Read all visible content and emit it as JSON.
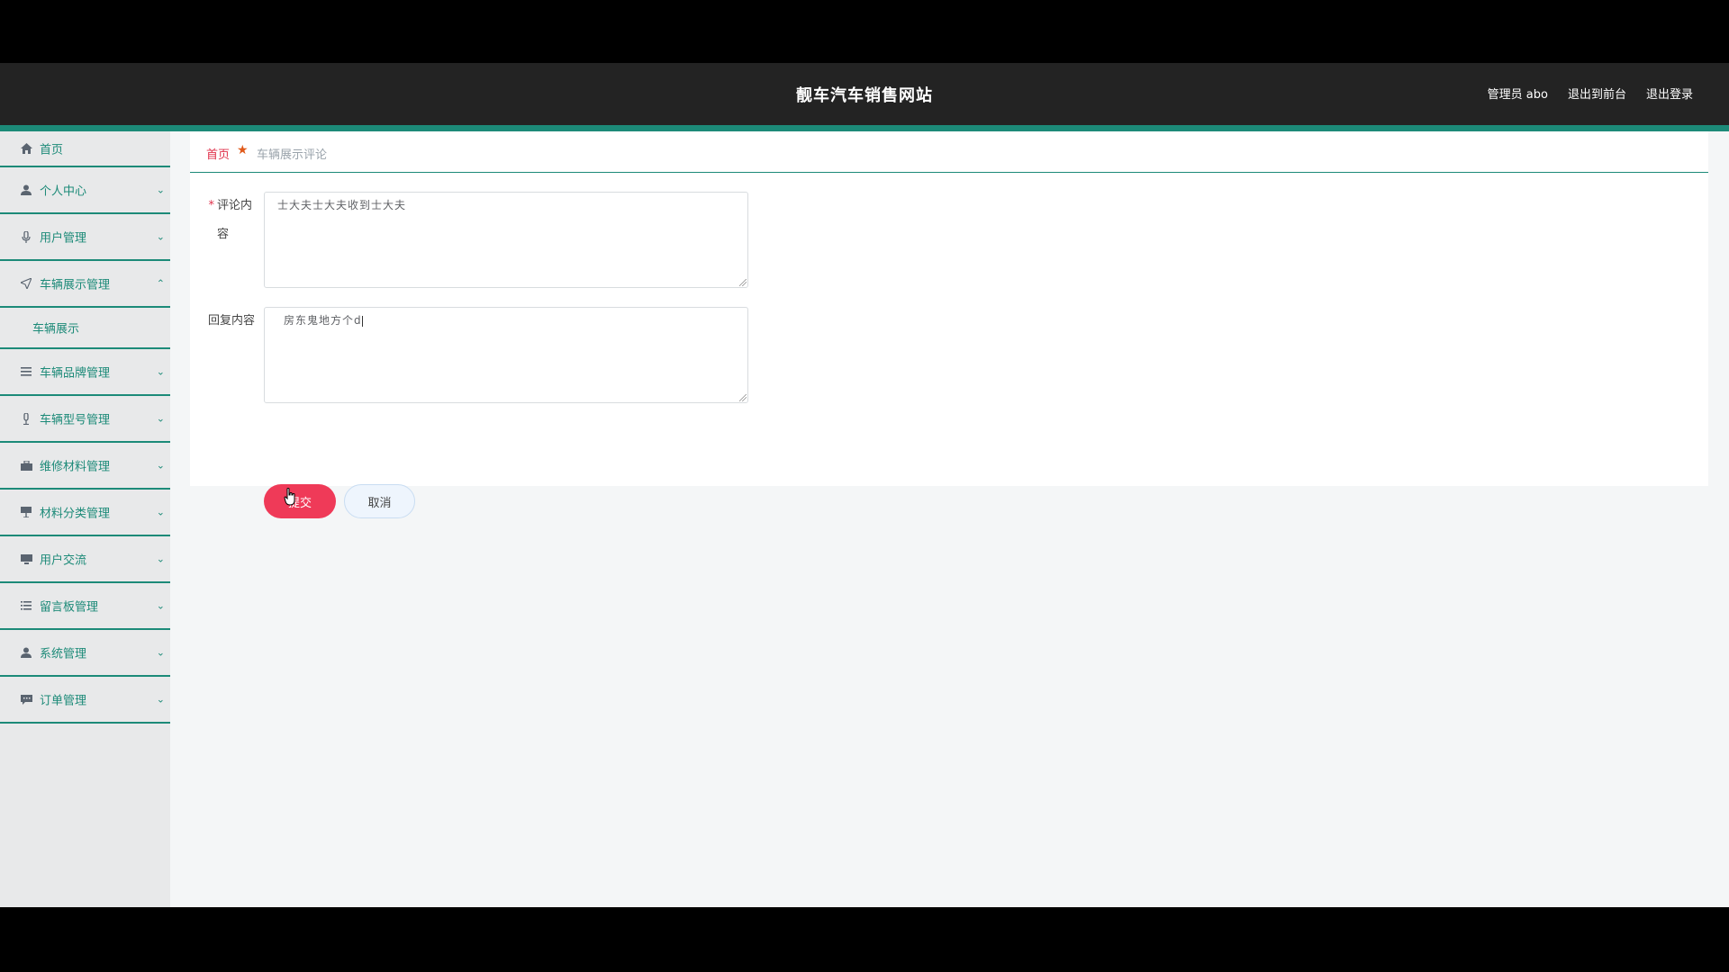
{
  "header": {
    "site_title": "靓车汽车销售网站",
    "admin_label": "管理员 abo",
    "exit_front": "退出到前台",
    "logout": "退出登录"
  },
  "sidebar": {
    "items": [
      {
        "label": "首页",
        "icon": "home-icon"
      },
      {
        "label": "个人中心",
        "icon": "user-icon"
      },
      {
        "label": "用户管理",
        "icon": "microphone-icon"
      },
      {
        "label": "车辆展示管理",
        "icon": "send-icon",
        "expanded": true
      },
      {
        "label": "车辆展示",
        "icon": ""
      },
      {
        "label": "车辆品牌管理",
        "icon": "list-icon"
      },
      {
        "label": "车辆型号管理",
        "icon": "microphone-icon"
      },
      {
        "label": "维修材料管理",
        "icon": "briefcase-icon"
      },
      {
        "label": "材料分类管理",
        "icon": "presentation-icon"
      },
      {
        "label": "用户交流",
        "icon": "monitor-icon"
      },
      {
        "label": "留言板管理",
        "icon": "list-icon"
      },
      {
        "label": "系统管理",
        "icon": "user-icon"
      },
      {
        "label": "订单管理",
        "icon": "chat-icon"
      }
    ]
  },
  "breadcrumb": {
    "home": "首页",
    "separator_icon": "star-icon",
    "current": "车辆展示评论"
  },
  "form": {
    "comment_label": "评论内容",
    "comment_value": "士大夫士大夫收到士大夫",
    "reply_label": "回复内容",
    "reply_value": "房东鬼地方个d",
    "submit_label": "提交",
    "cancel_label": "取消"
  },
  "colors": {
    "accent": "#1c8a78",
    "submit": "#ef3a58",
    "topbar": "#232323"
  }
}
